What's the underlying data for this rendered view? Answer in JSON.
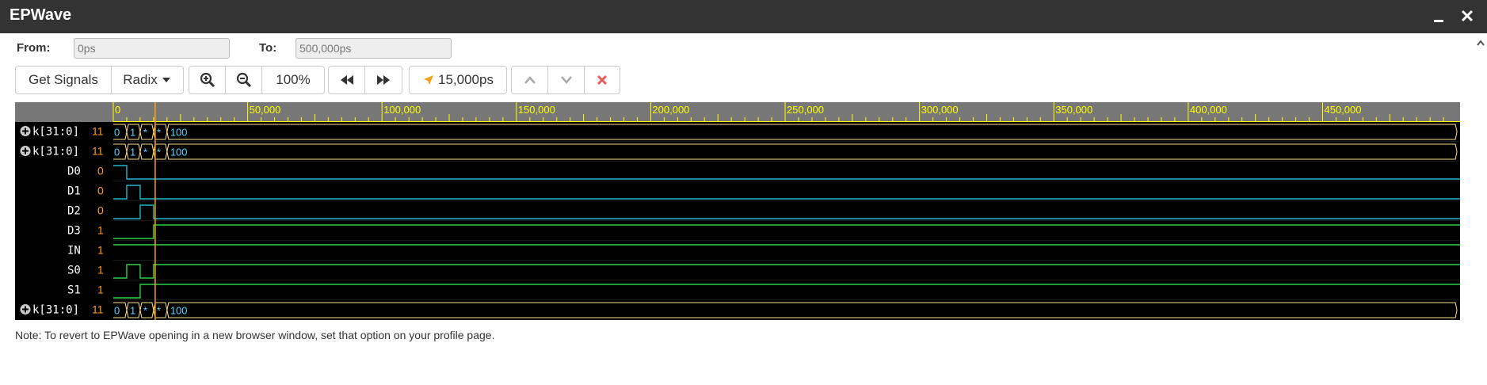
{
  "window": {
    "title": "EPWave",
    "minimize_icon": "minimize-icon",
    "close_icon": "close-icon"
  },
  "range": {
    "from_label": "From:",
    "from_value": "0ps",
    "to_label": "To:",
    "to_value": "500,000ps"
  },
  "toolbar": {
    "get_signals": "Get Signals",
    "radix": "Radix",
    "zoom": "100%",
    "cursor_time": "15,000ps",
    "icons": [
      "zoom-in-icon",
      "zoom-out-icon",
      "rewind-icon",
      "fast-forward-icon",
      "cursor-arrow-icon",
      "chevron-up-icon",
      "chevron-down-icon",
      "close-x-icon"
    ]
  },
  "ruler": {
    "ticks": [
      "0",
      "50,000",
      "100,000",
      "150,000",
      "200,000",
      "250,000",
      "300,000",
      "350,000",
      "400,000",
      "450,000"
    ],
    "tick_values": [
      0,
      50000,
      100000,
      150000,
      200000,
      250000,
      300000,
      350000,
      400000,
      450000
    ],
    "max": 500000
  },
  "cursor_ps": 15000,
  "signals": [
    {
      "name": "k[31:0]",
      "value": "11",
      "expandable": true,
      "type": "bus",
      "segments": [
        {
          "from": 0,
          "to": 5000,
          "label": "0"
        },
        {
          "from": 5000,
          "to": 10000,
          "label": "1"
        },
        {
          "from": 10000,
          "to": 15000,
          "label": "*"
        },
        {
          "from": 15000,
          "to": 20000,
          "label": "*"
        },
        {
          "from": 20000,
          "to": 500000,
          "label": "100"
        }
      ]
    },
    {
      "name": "k[31:0]",
      "value": "11",
      "expandable": true,
      "type": "bus",
      "segments": [
        {
          "from": 0,
          "to": 5000,
          "label": "0"
        },
        {
          "from": 5000,
          "to": 10000,
          "label": "1"
        },
        {
          "from": 10000,
          "to": 15000,
          "label": "*"
        },
        {
          "from": 15000,
          "to": 20000,
          "label": "*"
        },
        {
          "from": 20000,
          "to": 500000,
          "label": "100"
        }
      ]
    },
    {
      "name": "D0",
      "value": "0",
      "expandable": false,
      "type": "bit",
      "transitions": [
        [
          0,
          1
        ],
        [
          5000,
          0
        ]
      ]
    },
    {
      "name": "D1",
      "value": "0",
      "expandable": false,
      "type": "bit",
      "transitions": [
        [
          0,
          0
        ],
        [
          5000,
          1
        ],
        [
          10000,
          0
        ]
      ]
    },
    {
      "name": "D2",
      "value": "0",
      "expandable": false,
      "type": "bit",
      "transitions": [
        [
          0,
          0
        ],
        [
          10000,
          1
        ],
        [
          15000,
          0
        ]
      ]
    },
    {
      "name": "D3",
      "value": "1",
      "expandable": false,
      "type": "bit",
      "transitions": [
        [
          0,
          0
        ],
        [
          15000,
          1
        ]
      ]
    },
    {
      "name": "IN",
      "value": "1",
      "expandable": false,
      "type": "bit",
      "transitions": [
        [
          0,
          1
        ]
      ]
    },
    {
      "name": "S0",
      "value": "1",
      "expandable": false,
      "type": "bit",
      "transitions": [
        [
          0,
          0
        ],
        [
          5000,
          1
        ],
        [
          10000,
          0
        ],
        [
          15000,
          1
        ]
      ]
    },
    {
      "name": "S1",
      "value": "1",
      "expandable": false,
      "type": "bit",
      "transitions": [
        [
          0,
          0
        ],
        [
          10000,
          1
        ]
      ]
    },
    {
      "name": "k[31:0]",
      "value": "11",
      "expandable": true,
      "type": "bus",
      "segments": [
        {
          "from": 0,
          "to": 5000,
          "label": "0"
        },
        {
          "from": 5000,
          "to": 10000,
          "label": "1"
        },
        {
          "from": 10000,
          "to": 15000,
          "label": "*"
        },
        {
          "from": 15000,
          "to": 20000,
          "label": "*"
        },
        {
          "from": 20000,
          "to": 500000,
          "label": "100"
        }
      ]
    }
  ],
  "colors": {
    "bg": "#000000",
    "ruler_bg": "#777777",
    "ruler_text": "#ffff00",
    "bus": "#ffe08a",
    "bus_label": "#4fd4ff",
    "wave_low": "#22b8c8",
    "wave_high": "#2fd04a",
    "value": "#ff9a1f",
    "name": "#ffffff",
    "cursor": "#ffa500"
  },
  "note": "Note: To revert to EPWave opening in a new browser window, set that option on your profile page."
}
